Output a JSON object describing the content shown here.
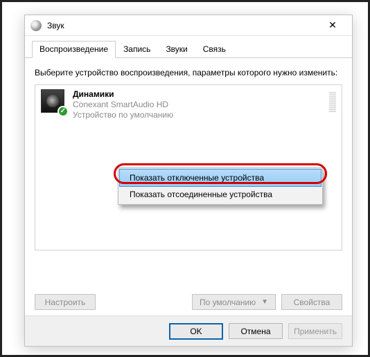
{
  "window": {
    "title": "Звук"
  },
  "tabs": {
    "playback": "Воспроизведение",
    "recording": "Запись",
    "sounds": "Звуки",
    "comm": "Связь"
  },
  "instruction": "Выберите устройство воспроизведения, параметры которого нужно изменить:",
  "device": {
    "name": "Динамики",
    "driver": "Conexant SmartAudio HD",
    "status": "Устройство по умолчанию"
  },
  "context_menu": {
    "show_disabled": "Показать отключенные устройства",
    "show_disconnected": "Показать отсоединенные устройства"
  },
  "buttons": {
    "configure": "Настроить",
    "set_default": "По умолчанию",
    "properties": "Свойства",
    "ok": "OK",
    "cancel": "Отмена",
    "apply": "Применить"
  }
}
